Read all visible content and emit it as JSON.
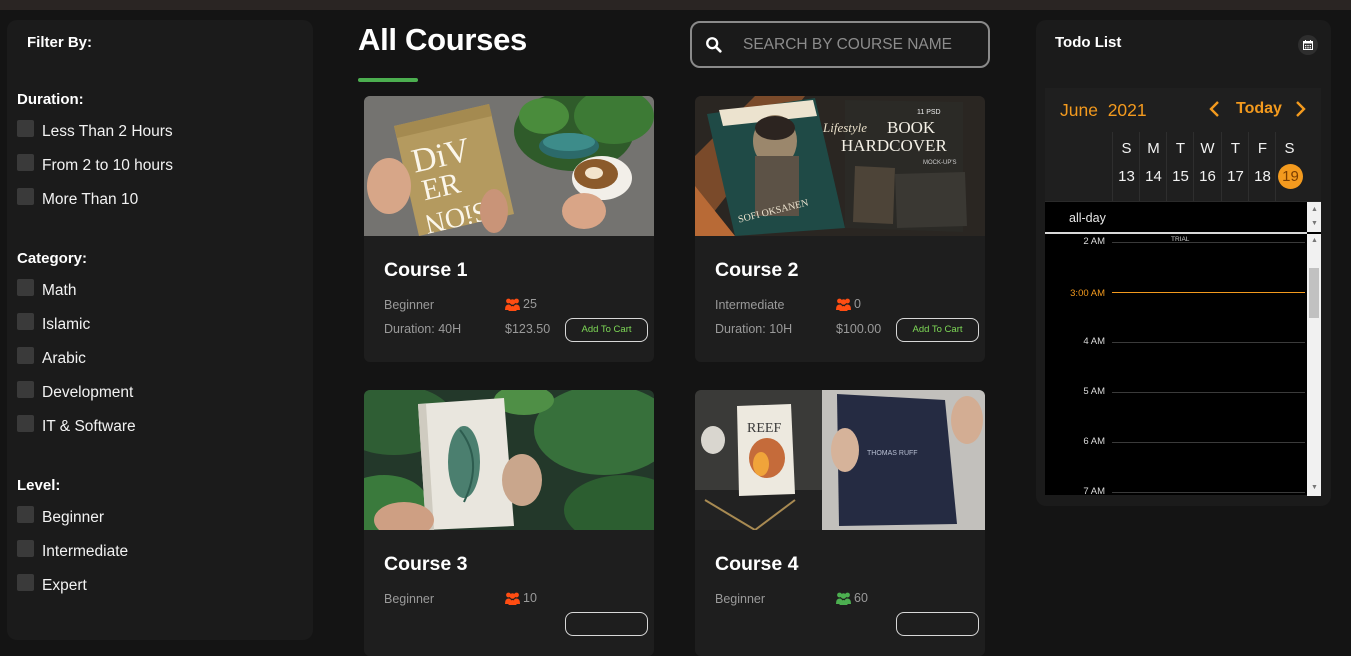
{
  "filters": {
    "title": "Filter By:",
    "groups": [
      {
        "title": "Duration:",
        "options": [
          "Less Than 2 Hours",
          "From 2 to 10 hours",
          "More Than 10"
        ]
      },
      {
        "title": "Category:",
        "options": [
          "Math",
          "Islamic",
          "Arabic",
          "Development",
          "IT & Software"
        ]
      },
      {
        "title": "Level:",
        "options": [
          "Beginner",
          "Intermediate",
          "Expert"
        ]
      }
    ]
  },
  "main": {
    "title": "All Courses",
    "accent_color": "#4caf50",
    "search": {
      "placeholder": "SEARCH BY COURSE NAME",
      "value": ""
    }
  },
  "courses": [
    {
      "title": "Course 1",
      "level": "Beginner",
      "students": "25",
      "student_icon_color": "#ff4d12",
      "duration": "Duration: 40H",
      "price": "$123.50",
      "cart_label": "Add To Cart"
    },
    {
      "title": "Course 2",
      "level": "Intermediate",
      "students": "0",
      "student_icon_color": "#ff4d12",
      "duration": "Duration: 10H",
      "price": "$100.00",
      "cart_label": "Add To Cart"
    },
    {
      "title": "Course 3",
      "level": "Beginner",
      "students": "10",
      "student_icon_color": "#ff4d12",
      "duration": "",
      "price": "",
      "cart_label": ""
    },
    {
      "title": "Course 4",
      "level": "Beginner",
      "students": "60",
      "student_icon_color": "#4caf50",
      "duration": "",
      "price": "",
      "cart_label": ""
    }
  ],
  "book_covers": {
    "c1": [
      "DiV",
      "ER",
      "SiON"
    ],
    "c2": {
      "badge": "11 PSD",
      "line1": "BOOK",
      "line2": "HARDCOVER",
      "line3": "MOCK-UP'S",
      "script": "Lifestyle",
      "author": "SOFI OKSANEN"
    },
    "c4": {
      "left_title": "REEF",
      "right_title": "THOMAS RUFF"
    }
  },
  "todo": {
    "title": "Todo List",
    "month": "June",
    "year": "2021",
    "today_label": "Today",
    "accent_color": "#f39a1e",
    "days": [
      {
        "name": "S",
        "date": "13"
      },
      {
        "name": "M",
        "date": "14"
      },
      {
        "name": "T",
        "date": "15"
      },
      {
        "name": "W",
        "date": "16"
      },
      {
        "name": "T",
        "date": "17"
      },
      {
        "name": "F",
        "date": "18"
      },
      {
        "name": "S",
        "date": "19",
        "today": true
      }
    ],
    "allday_label": "all-day",
    "event_label": "TRIAL",
    "times": [
      "2 AM",
      "3:00 AM",
      "4 AM",
      "5 AM",
      "6 AM",
      "7 AM"
    ],
    "current_time": "3:00 AM"
  },
  "icons": {
    "search": "search-icon",
    "calendar": "calendar-icon",
    "students": "users-icon",
    "prev": "chevron-left-icon",
    "next": "chevron-right-icon"
  }
}
